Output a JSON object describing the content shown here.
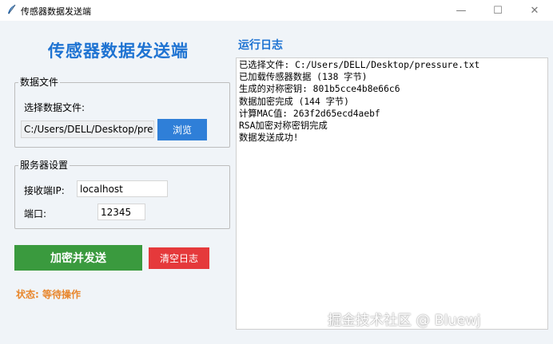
{
  "window": {
    "title": "传感器数据发送端",
    "minimize_glyph": "—",
    "maximize_glyph": "☐",
    "close_glyph": "✕"
  },
  "app_title": "传感器数据发送端",
  "data_file": {
    "group_label": "数据文件",
    "select_label": "选择数据文件:",
    "path_value": "C:/Users/DELL/Desktop/pressure.txt",
    "browse_label": "浏览"
  },
  "server": {
    "group_label": "服务器设置",
    "ip_label": "接收端IP:",
    "ip_value": "localhost",
    "port_label": "端口:",
    "port_value": "12345"
  },
  "actions": {
    "send_label": "加密并发送",
    "clear_label": "清空日志",
    "send_color": "#3a9a3e",
    "clear_color": "#e5393b"
  },
  "status_text": "状态: 等待操作",
  "log": {
    "title": "运行日志",
    "lines": [
      "已选择文件: C:/Users/DELL/Desktop/pressure.txt",
      "已加载传感器数据 (138 字节)",
      "生成的对称密钥: 801b5cce4b8e66c6",
      "数据加密完成 (144 字节)",
      "计算MAC值: 263f2d65ecd4aebf",
      "RSA加密对称密钥完成",
      "数据发送成功!"
    ]
  },
  "watermark": "掘金技术社区 @ Bluewj",
  "colors": {
    "accent_blue": "#1e73d2",
    "status_orange": "#e8862b",
    "background": "#f0f4f8"
  },
  "icons": {
    "app": "feather-icon"
  }
}
